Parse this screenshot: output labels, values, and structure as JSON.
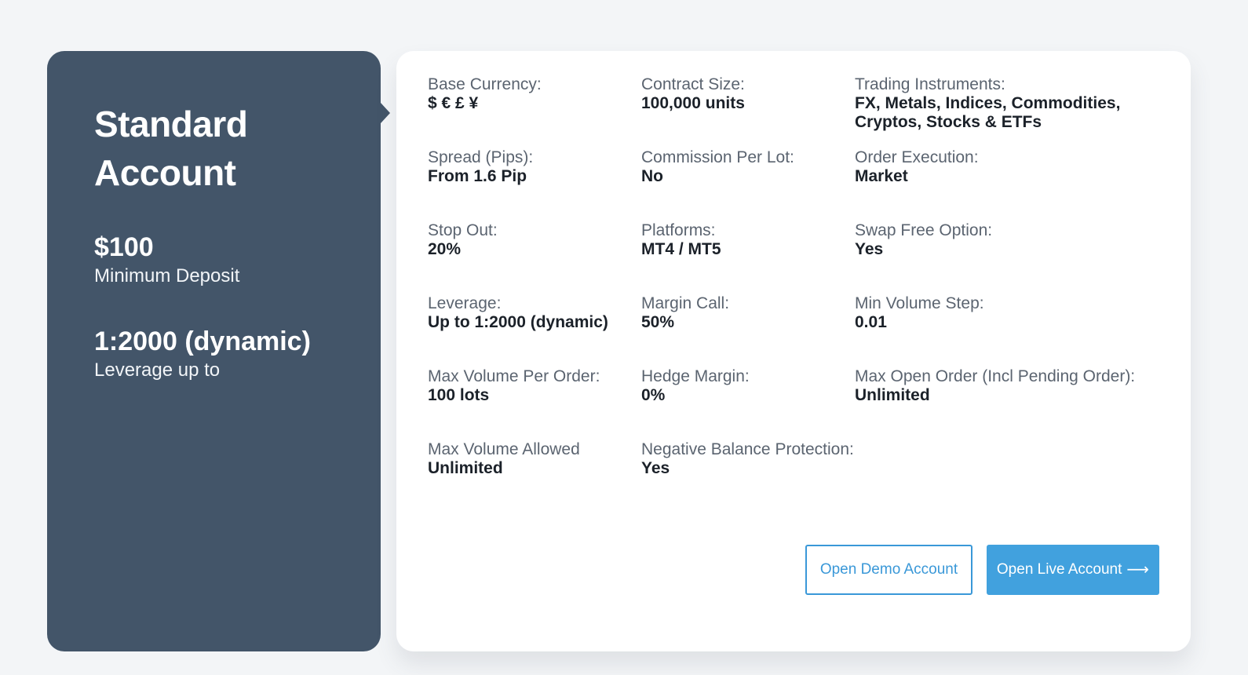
{
  "account": {
    "title_line1": "Standard",
    "title_line2": "Account",
    "min_deposit_value": "$100",
    "min_deposit_caption": "Minimum Deposit",
    "leverage_value": "1:2000 (dynamic)",
    "leverage_caption": "Leverage up to"
  },
  "specs": [
    {
      "label": "Base Currency:",
      "value": "$ € £ ¥"
    },
    {
      "label": "Contract Size:",
      "value": "100,000 units"
    },
    {
      "label": "Trading Instruments:",
      "value": "FX, Metals, Indices, Commodities, Cryptos, Stocks & ETFs"
    },
    {
      "label": "Spread (Pips):",
      "value": "From 1.6 Pip"
    },
    {
      "label": "Commission Per Lot:",
      "value": "No"
    },
    {
      "label": "Order Execution:",
      "value": "Market"
    },
    {
      "label": "Stop Out:",
      "value": "20%"
    },
    {
      "label": "Platforms:",
      "value": "MT4 / MT5"
    },
    {
      "label": "Swap Free Option:",
      "value": "Yes"
    },
    {
      "label": "Leverage:",
      "value": "Up to 1:2000 (dynamic)"
    },
    {
      "label": "Margin Call:",
      "value": "50%"
    },
    {
      "label": "Min Volume Step:",
      "value": "0.01"
    },
    {
      "label": "Max Volume Per Order:",
      "value": "100 lots"
    },
    {
      "label": "Hedge Margin:",
      "value": "0%"
    },
    {
      "label": "Max Open Order (Incl Pending Order):",
      "value": "Unlimited"
    },
    {
      "label": "Max Volume Allowed",
      "value": "Unlimited"
    },
    {
      "label": "Negative Balance Protection:",
      "value": "Yes"
    }
  ],
  "actions": {
    "demo_label": "Open Demo Account",
    "live_label": "Open Live Account",
    "live_icon": "arrow-right-icon"
  },
  "colors": {
    "panel": "#435569",
    "accent": "#41a1de",
    "background": "#f3f5f7"
  }
}
